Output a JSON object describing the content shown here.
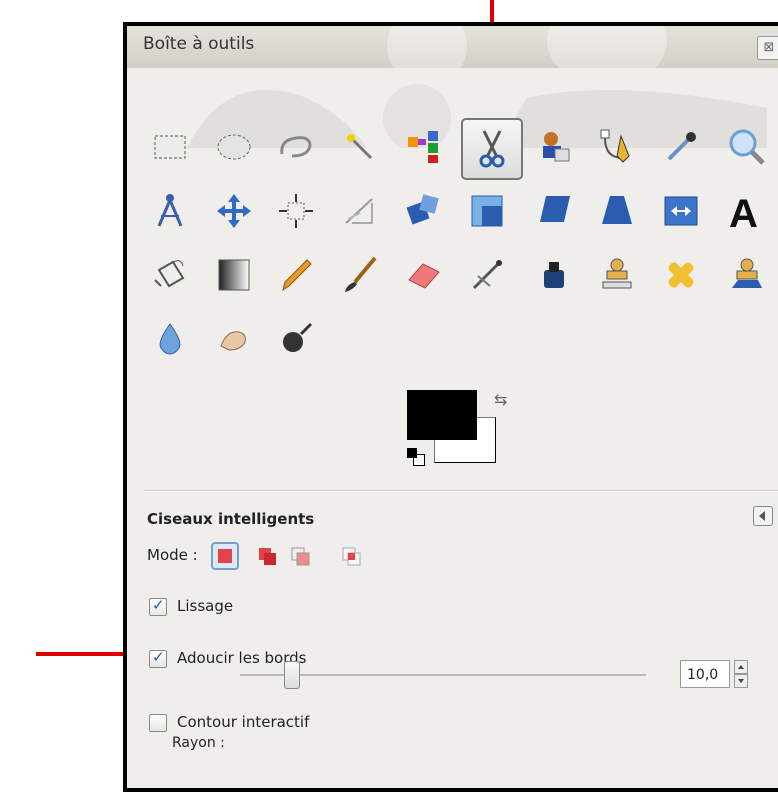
{
  "window": {
    "title": "Boîte à outils",
    "close_label": "⊠"
  },
  "toolbox": {
    "selected_tool": "tool-intelligent-scissors",
    "rows": [
      [
        "rect-select-icon",
        "ellipse-select-icon",
        "lasso-icon",
        "magic-wand-icon",
        "select-by-color-icon",
        "scissors-icon",
        "foreground-select-icon",
        "paths-icon",
        "color-picker-icon",
        "zoom-icon"
      ],
      [
        "measure-icon",
        "move-icon",
        "align-icon",
        "crop-icon",
        "rotate-icon",
        "scale-icon",
        "shear-icon",
        "perspective-icon",
        "flip-icon",
        "text-icon"
      ],
      [
        "bucket-fill-icon",
        "blend-icon",
        "pencil-icon",
        "paintbrush-icon",
        "eraser-icon",
        "airbrush-icon",
        "ink-icon",
        "clone-icon",
        "heal-icon",
        "perspective-clone-icon"
      ],
      [
        "blur-icon",
        "smudge-icon",
        "dodge-burn-icon"
      ]
    ]
  },
  "tool_options": {
    "title": "Ciseaux intelligents",
    "mode_label": "Mode :",
    "lissage_label": "Lissage",
    "lissage_checked": true,
    "adoucir_label": "Adoucir les bords",
    "adoucir_checked": true,
    "rayon_label": "Rayon :",
    "rayon_value": "10,0",
    "contour_label": "Contour interactif",
    "contour_checked": false
  },
  "colors": {
    "accent_arrow": "#e10000",
    "foreground": "#000000",
    "background": "#ffffff"
  }
}
